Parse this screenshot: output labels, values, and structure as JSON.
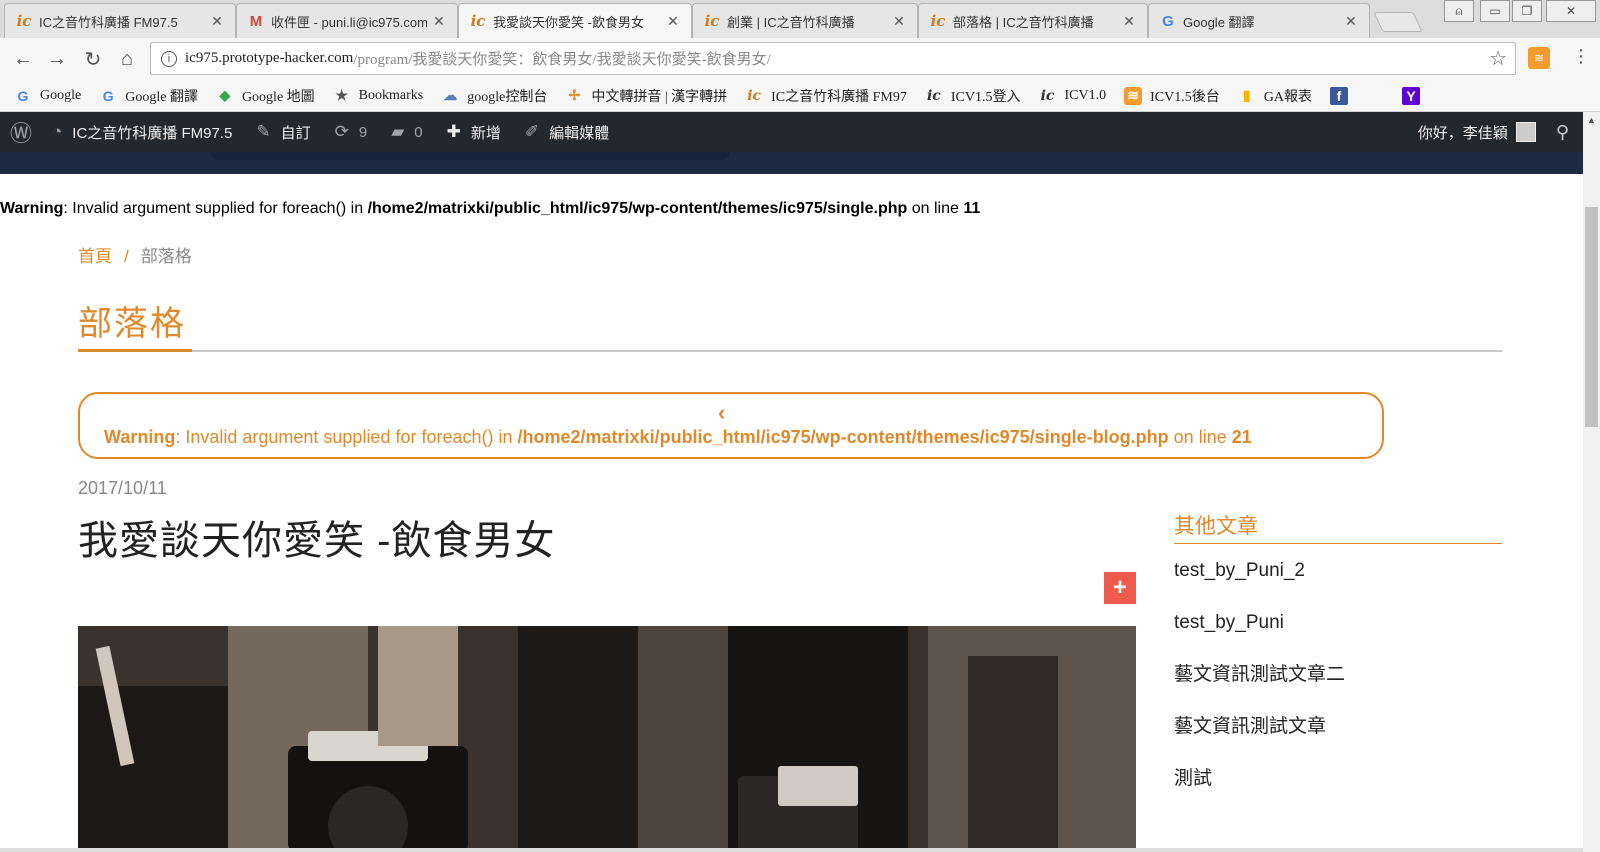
{
  "tabs": [
    {
      "title": "IC之音竹科廣播 FM97.5",
      "favicon": "ic"
    },
    {
      "title": "收件匣 - puni.li@ic975.com",
      "favicon": "M"
    },
    {
      "title": "我愛談天你愛笑 -飲食男女",
      "favicon": "ic",
      "active": true
    },
    {
      "title": "創業 | IC之音竹科廣播",
      "favicon": "ic"
    },
    {
      "title": "部落格 | IC之音竹科廣播",
      "favicon": "ic"
    },
    {
      "title": "Google 翻譯",
      "favicon": "G"
    }
  ],
  "address": {
    "host": "ic975.prototype-hacker.com",
    "path": "/program/我愛談天你愛笑：飲食男女/我愛談天你愛笑-飲食男女/"
  },
  "bookmarks": [
    {
      "label": "Google",
      "icon": "G"
    },
    {
      "label": "Google 翻譯",
      "icon": "G"
    },
    {
      "label": "Google 地圖",
      "icon": "◆"
    },
    {
      "label": "Bookmarks",
      "icon": "★"
    },
    {
      "label": "google控制台",
      "icon": "☁"
    },
    {
      "label": "中文轉拼音 | 漢字轉拼",
      "icon": "✢"
    },
    {
      "label": "IC之音竹科廣播 FM97",
      "icon": "ic"
    },
    {
      "label": "ICV1.5登入",
      "icon": "ic"
    },
    {
      "label": "ICV1.0",
      "icon": "ic"
    },
    {
      "label": "ICV1.5後台",
      "icon": "≋"
    },
    {
      "label": "GA報表",
      "icon": "▮"
    },
    {
      "label": "",
      "icon": "f"
    },
    {
      "label": "",
      "icon": "Y"
    }
  ],
  "wpbar": {
    "site": "IC之音竹科廣播 FM97.5",
    "customize": "自訂",
    "updates": "9",
    "comments": "0",
    "new": "新增",
    "edit_media": "編輯媒體",
    "greeting": "你好，李佳穎"
  },
  "warning_top": {
    "label": "Warning",
    "text": ": Invalid argument supplied for foreach() in ",
    "path": "/home2/matrixki/public_html/ic975/wp-content/themes/ic975/single.php",
    "online": " on line ",
    "line": "11"
  },
  "breadcrumb": {
    "home": "首頁",
    "sep": "/",
    "current": "部落格"
  },
  "page_title": "部落格",
  "warning_box": {
    "label": "Warning",
    "text": ": Invalid argument supplied for foreach() in ",
    "path": "/home2/matrixki/public_html/ic975/wp-content/themes/ic975/single-blog.php",
    "online": " on line ",
    "line": "21"
  },
  "post": {
    "date": "2017/10/11",
    "title": "我愛談天你愛笑 -飲食男女",
    "share": "+"
  },
  "sidebar": {
    "heading": "其他文章",
    "items": [
      "test_by_Puni_2",
      "test_by_Puni",
      "藝文資訊測試文章二",
      "藝文資訊測試文章",
      "測試"
    ]
  },
  "colors": {
    "accent": "#e0892a",
    "wpbar": "#23282d",
    "share": "#ef5a4c"
  }
}
